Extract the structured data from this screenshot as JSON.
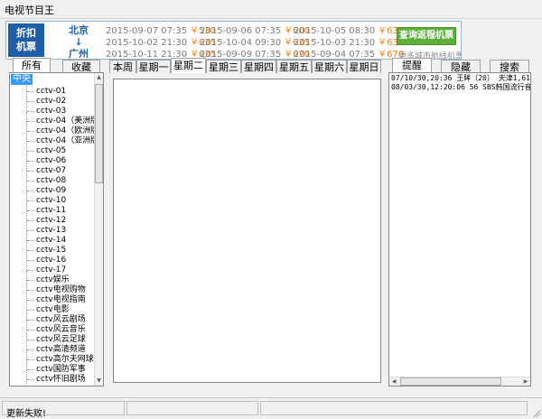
{
  "window": {
    "title": "电视节目王"
  },
  "ad": {
    "badge": [
      "折扣",
      "机票"
    ],
    "route": [
      "北京",
      "↓",
      "广州"
    ],
    "fares": [
      [
        {
          "date": "2015-09-07 07:35",
          "price": "￥530"
        },
        {
          "date": "2015-10-02 21:30",
          "price": "￥635"
        },
        {
          "date": "2015-10-11 21:30",
          "price": "￥635"
        }
      ],
      [
        {
          "date": "2015-09-06 07:35",
          "price": "￥600"
        },
        {
          "date": "2015-10-04 09:30",
          "price": "￥635"
        },
        {
          "date": "2015-09-09 07:35",
          "price": "￥670"
        }
      ],
      [
        {
          "date": "2015-10-05 08:30",
          "price": "￥635"
        },
        {
          "date": "2015-10-03 21:30",
          "price": "￥635"
        },
        {
          "date": "2015-09-04 07:35",
          "price": "￥670"
        }
      ]
    ],
    "button_label": "查询返程机票",
    "note": "更多城市航线机票"
  },
  "left_tabs": [
    "所有",
    "收藏"
  ],
  "day_tabs": [
    "本周",
    "星期一",
    "星期二",
    "星期三",
    "星期四",
    "星期五",
    "星期六",
    "星期日"
  ],
  "active_day_tab": 2,
  "right_tabs": [
    "提醒",
    "隐藏",
    "搜索"
  ],
  "tree": {
    "root": "中央",
    "items": [
      "cctv-01",
      "cctv-02",
      "cctv-03",
      "cctv-04（美洲版）",
      "cctv-04（欧洲版）",
      "cctv-04（亚洲版）",
      "cctv-05",
      "cctv-06",
      "cctv-07",
      "cctv-08",
      "cctv-09",
      "cctv-10",
      "cctv-11",
      "cctv-12",
      "cctv-13",
      "cctv-14",
      "cctv-15",
      "cctv-16",
      "cctv-17",
      "cctv娱乐",
      "cctv电视购物",
      "cctv电视指南",
      "cctv电影",
      "cctv风云剧场",
      "cctv风云音乐",
      "cctv风云足球",
      "cctv高清频道",
      "cctv高尔夫网球",
      "cctv国防军事",
      "cctv怀旧剧场"
    ]
  },
  "reminders": [
    "07/10/30,20:36 王眸（20） 天津1,61",
    "08/03/30,12:20:06 56    SBS韩国流行音乐"
  ],
  "status": {
    "message": "更新失败!"
  }
}
